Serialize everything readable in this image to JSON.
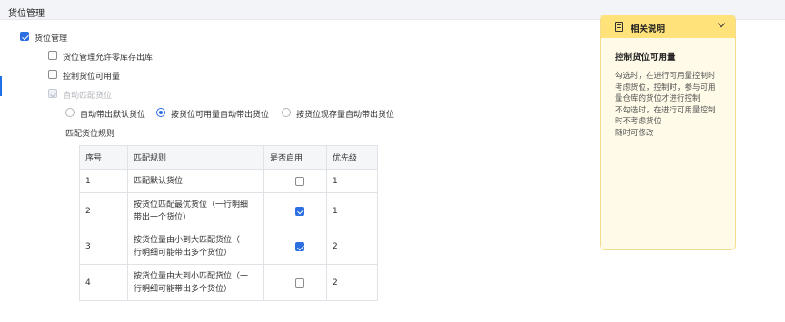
{
  "header": {
    "title": "货位管理"
  },
  "settings": {
    "main": {
      "label": "货位管理",
      "checked": true
    },
    "options": [
      {
        "label": "货位管理允许零库存出库",
        "checked": false
      },
      {
        "label": "控制货位可用量",
        "checked": false
      },
      {
        "label": "自动匹配货位",
        "checked": true,
        "disabled": true
      }
    ],
    "radios": [
      {
        "label": "自动带出默认货位",
        "selected": false
      },
      {
        "label": "按货位可用量自动带出货位",
        "selected": true
      },
      {
        "label": "按货位现存量自动带出货位",
        "selected": false
      }
    ],
    "rules_title": "匹配货位规则"
  },
  "table": {
    "headers": [
      "序号",
      "匹配规则",
      "是否启用",
      "优先级"
    ],
    "rows": [
      {
        "no": "1",
        "rule_lines": [
          "匹配默认货位"
        ],
        "enabled": false,
        "priority": "1"
      },
      {
        "no": "2",
        "rule_lines": [
          "按货位匹配最优货位（一行明细",
          "带出一个货位）"
        ],
        "enabled": true,
        "priority": "1"
      },
      {
        "no": "3",
        "rule_lines": [
          "按货位量由小到大匹配货位（一",
          "行明细可能带出多个货位）"
        ],
        "enabled": true,
        "priority": "2"
      },
      {
        "no": "4",
        "rule_lines": [
          "按货位量由大到小匹配货位（一",
          "行明细可能带出多个货位）"
        ],
        "enabled": false,
        "priority": "2"
      }
    ]
  },
  "help_panel": {
    "title": "相关说明",
    "subtitle": "控制货位可用量",
    "lines": [
      "勾选时，在进行可用量控制时",
      "考虑货位，控制时，参与可用",
      "量仓库的货位才进行控制",
      "不勾选时，在进行可用量控制",
      "时不考虑货位",
      "随时可修改"
    ],
    "bg_color": "#fffbe8",
    "header_color": "#ffe27a"
  },
  "colors": {
    "accent": "#2b6fe0"
  }
}
